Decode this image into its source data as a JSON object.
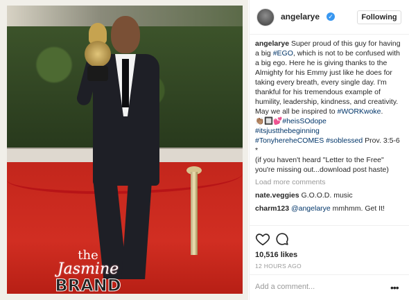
{
  "post": {
    "image_alt": "",
    "watermark": {
      "line1": "the",
      "line2": "Jasmine",
      "line3": "BRAND"
    }
  },
  "header": {
    "username": "angelarye",
    "follow_label": "Following"
  },
  "caption": {
    "username": "angelarye",
    "segments": [
      " Super proud of this guy for having a big ",
      "#EGO",
      ", which is not to be confused with a big ego. Here he is giving thanks to the Almighty for his Emmy just like he does for taking every breath, every single day. I'm thankful for his tremendous example of humility, leadership, kindness, and creativity. May we all be inspired to ",
      "#WORKwoke",
      ". ",
      "👏🏽🔲💕",
      "#heisSOdope",
      "#itsjustthebeginning",
      "#TonyhereheCOMES",
      " ",
      "#soblessed",
      " Prov. 3:5-6 *",
      "(if you haven't heard \"Letter to the Free\" you're missing out...download post haste)"
    ]
  },
  "load_more": "Load more comments",
  "comments": [
    {
      "user": "nate.veggies",
      "text": "G.O.O.D. music",
      "mention": ""
    },
    {
      "user": "charm123",
      "text": " mmhmm. Get It!",
      "mention": "@angelarye"
    }
  ],
  "actions": {
    "likes": "10,516 likes",
    "timestamp": "12 HOURS AGO",
    "comment_placeholder": "Add a comment...",
    "more": "•••"
  },
  "colors": {
    "verified": "#3897f0",
    "hashtag": "#003569",
    "muted": "#999999"
  },
  "icons": [
    "heart-icon",
    "comment-icon",
    "verified-badge-icon",
    "more-options-icon"
  ]
}
